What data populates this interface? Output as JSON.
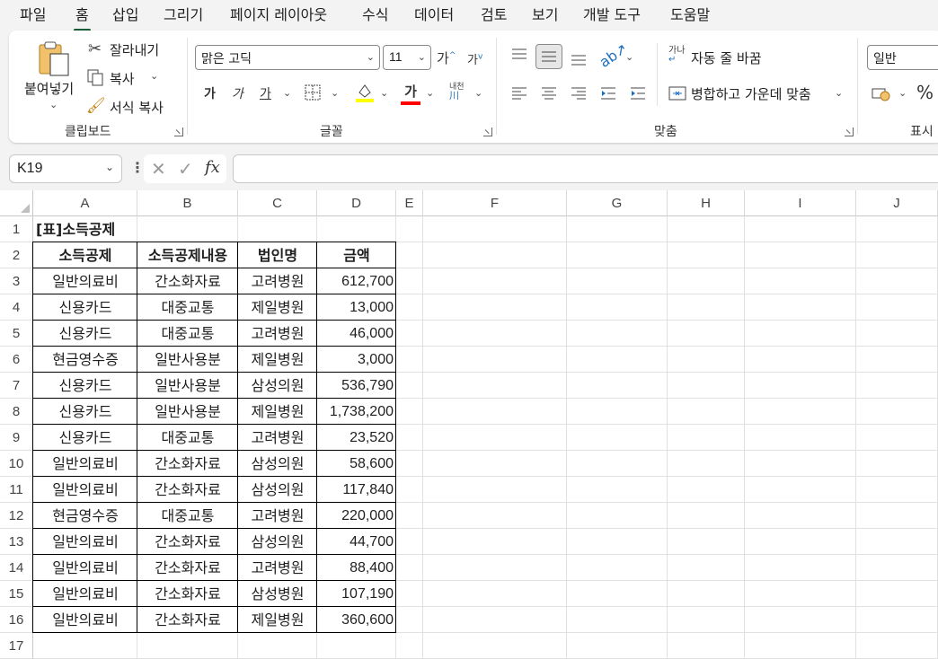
{
  "menu": [
    "파일",
    "홈",
    "삽입",
    "그리기",
    "페이지 레이아웃",
    "수식",
    "데이터",
    "검토",
    "보기",
    "개발 도구",
    "도움말"
  ],
  "ribbon": {
    "clipboard": {
      "paste": "붙여넣기",
      "cut": "잘라내기",
      "copy": "복사",
      "format_painter": "서식 복사",
      "group": "클립보드"
    },
    "font": {
      "name": "맑은 고딕",
      "size": "11",
      "grow": "가",
      "shrink": "가",
      "bold": "가",
      "italic": "가",
      "underline": "가",
      "fill_color_hex": "#ffff00",
      "font_color_hex": "#ff0000",
      "font_color_glyph": "가",
      "phonetic": "내천",
      "group": "글꼴"
    },
    "alignment": {
      "wrap": "자동 줄 바꿈",
      "merge": "병합하고 가운데 맞춤",
      "group": "맞춤",
      "wrap_icon": "가나"
    },
    "number": {
      "format": "일반",
      "group": "표시",
      "percent": "%"
    }
  },
  "formula_bar": {
    "name_box": "K19",
    "fx": "fx",
    "formula": ""
  },
  "columns": [
    "A",
    "B",
    "C",
    "D",
    "E",
    "F",
    "G",
    "H",
    "I",
    "J"
  ],
  "rows": [
    "1",
    "2",
    "3",
    "4",
    "5",
    "6",
    "7",
    "8",
    "9",
    "10",
    "11",
    "12",
    "13",
    "14",
    "15",
    "16",
    "17"
  ],
  "sheet": {
    "title": "[표]소득공제",
    "headers": [
      "소득공제",
      "소득공제내용",
      "법인명",
      "금액"
    ],
    "records": [
      [
        "일반의료비",
        "간소화자료",
        "고려병원",
        "612,700"
      ],
      [
        "신용카드",
        "대중교통",
        "제일병원",
        "13,000"
      ],
      [
        "신용카드",
        "대중교통",
        "고려병원",
        "46,000"
      ],
      [
        "현금영수증",
        "일반사용분",
        "제일병원",
        "3,000"
      ],
      [
        "신용카드",
        "일반사용분",
        "삼성의원",
        "536,790"
      ],
      [
        "신용카드",
        "일반사용분",
        "제일병원",
        "1,738,200"
      ],
      [
        "신용카드",
        "대중교통",
        "고려병원",
        "23,520"
      ],
      [
        "일반의료비",
        "간소화자료",
        "삼성의원",
        "58,600"
      ],
      [
        "일반의료비",
        "간소화자료",
        "삼성의원",
        "117,840"
      ],
      [
        "현금영수증",
        "대중교통",
        "고려병원",
        "220,000"
      ],
      [
        "일반의료비",
        "간소화자료",
        "삼성의원",
        "44,700"
      ],
      [
        "일반의료비",
        "간소화자료",
        "고려병원",
        "88,400"
      ],
      [
        "일반의료비",
        "간소화자료",
        "삼성병원",
        "107,190"
      ],
      [
        "일반의료비",
        "간소화자료",
        "제일병원",
        "360,600"
      ]
    ]
  },
  "colors": {
    "accent": "#185c37",
    "ribbon_bg": "#ffffff",
    "window_bg": "#f3f3f3"
  }
}
